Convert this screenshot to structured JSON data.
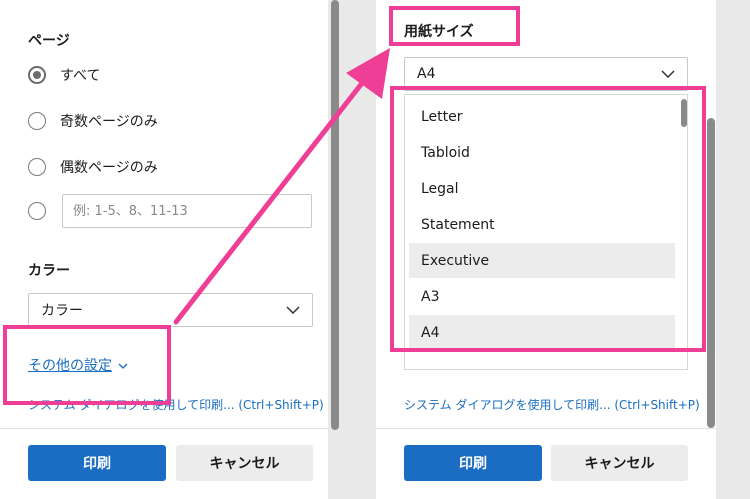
{
  "left_panel": {
    "pages_label": "ページ",
    "radio_options": [
      {
        "label": "すべて",
        "checked": true
      },
      {
        "label": "奇数ページのみ",
        "checked": false
      },
      {
        "label": "偶数ページのみ",
        "checked": false
      }
    ],
    "custom_range_placeholder": "例: 1-5、8、11-13",
    "color_label": "カラー",
    "color_select_value": "カラー",
    "more_settings": "その他の設定",
    "system_dialog_link": "システム ダイアログを使用して印刷... (Ctrl+Shift+P)",
    "print_button": "印刷",
    "cancel_button": "キャンセル"
  },
  "right_panel": {
    "paper_size_label": "用紙サイズ",
    "paper_size_value": "A4",
    "paper_options": [
      {
        "label": "Letter",
        "highlighted": false
      },
      {
        "label": "Tabloid",
        "highlighted": false
      },
      {
        "label": "Legal",
        "highlighted": false
      },
      {
        "label": "Statement",
        "highlighted": false
      },
      {
        "label": "Executive",
        "highlighted": true
      },
      {
        "label": "A3",
        "highlighted": false
      },
      {
        "label": "A4",
        "highlighted": true
      }
    ],
    "system_dialog_link": "システム ダイアログを使用して印刷... (Ctrl+Shift+P)",
    "print_button": "印刷",
    "cancel_button": "キャンセル"
  },
  "colors": {
    "accent_blue": "#1a6dc2",
    "annotation_pink": "#ee3e96"
  }
}
